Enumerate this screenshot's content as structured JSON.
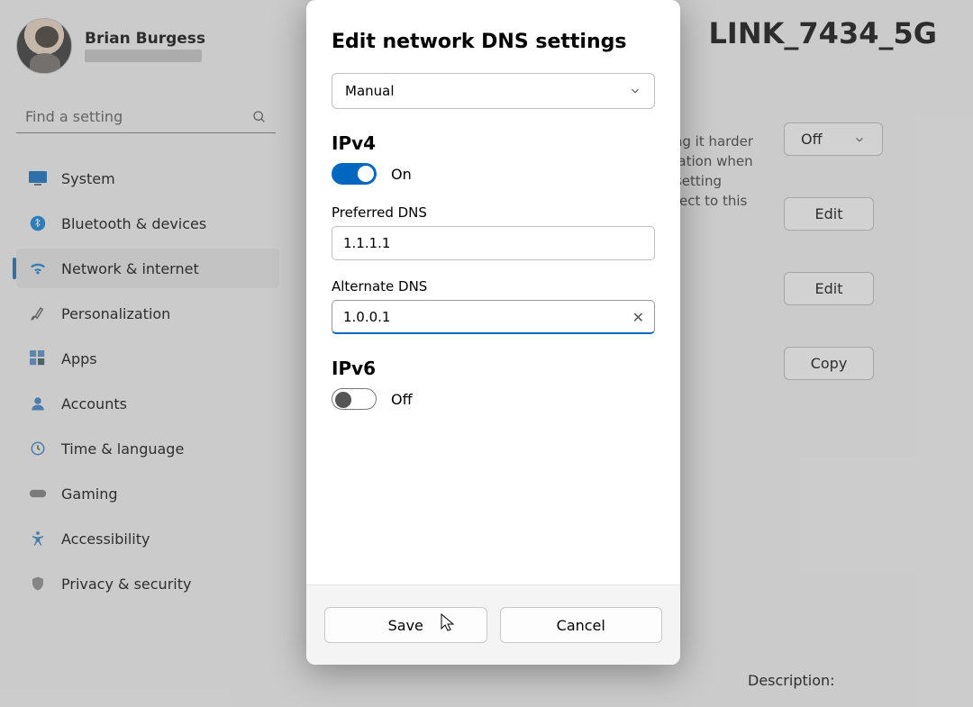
{
  "user": {
    "name": "Brian Burgess"
  },
  "search": {
    "placeholder": "Find a setting"
  },
  "nav": {
    "items": [
      {
        "label": "System",
        "icon": "system"
      },
      {
        "label": "Bluetooth & devices",
        "icon": "bluetooth"
      },
      {
        "label": "Network & internet",
        "icon": "wifi",
        "active": true
      },
      {
        "label": "Personalization",
        "icon": "brush"
      },
      {
        "label": "Apps",
        "icon": "apps"
      },
      {
        "label": "Accounts",
        "icon": "person"
      },
      {
        "label": "Time & language",
        "icon": "clock"
      },
      {
        "label": "Gaming",
        "icon": "gaming"
      },
      {
        "label": "Accessibility",
        "icon": "accessibility"
      },
      {
        "label": "Privacy & security",
        "icon": "shield"
      }
    ]
  },
  "page": {
    "network_title_fragment": "LINK_7434_5G",
    "bg_text": "king it harder\nocation when\ne setting\nnnect to this",
    "off_label": "Off",
    "edit_label": "Edit",
    "copy_label": "Copy",
    "description_label": "Description:"
  },
  "modal": {
    "title": "Edit network DNS settings",
    "mode": "Manual",
    "ipv4": {
      "heading": "IPv4",
      "state": "On",
      "preferred_label": "Preferred DNS",
      "preferred_value": "1.1.1.1",
      "alternate_label": "Alternate DNS",
      "alternate_value": "1.0.0.1"
    },
    "ipv6": {
      "heading": "IPv6",
      "state": "Off"
    },
    "save": "Save",
    "cancel": "Cancel"
  }
}
